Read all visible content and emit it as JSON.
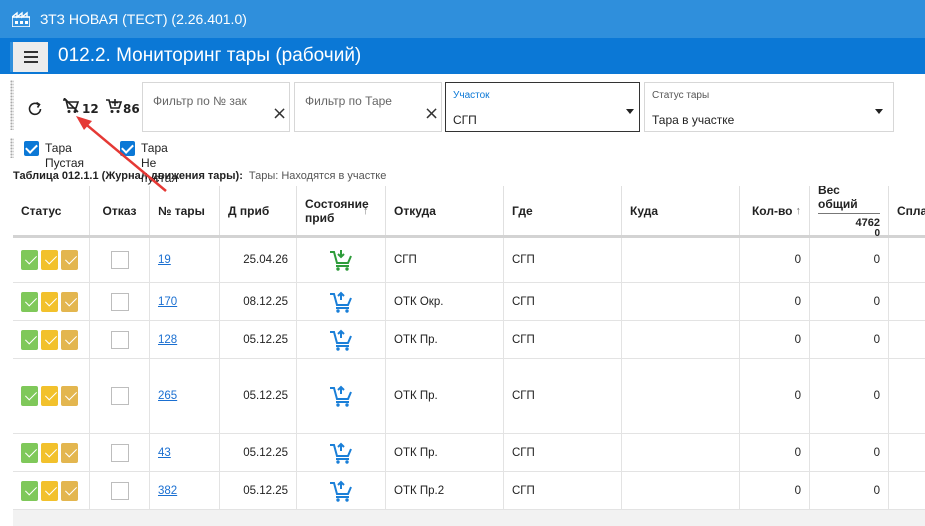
{
  "app": {
    "title": "ЗТЗ НОВАЯ (ТЕСТ) (2.26.401.0)"
  },
  "header": {
    "page_title": "012.2. Мониторинг тары (рабочий)"
  },
  "toolbar": {
    "empty_cart_count": "12",
    "full_cart_count": "86",
    "filter_order_placeholder": "Фильтр по № зак",
    "filter_tara_placeholder": "Фильтр по Таре",
    "area": {
      "label": "Участок",
      "value": "СГП"
    },
    "status": {
      "label": "Статус тары",
      "value": "Тара в участке"
    }
  },
  "checkboxes": {
    "empty": "Тара Пустая",
    "not_empty": "Тара Не пустая"
  },
  "table": {
    "caption": "Таблица 012.1.1 (Журнал движения тары):",
    "subcaption": "Тары: Находятся в участке",
    "headers": {
      "status": "Статус",
      "otkaz": "Отказ",
      "num": "№ тары",
      "date": "Д приб",
      "state": "Состояние приб",
      "from": "Откуда",
      "where": "Где",
      "to": "Куда",
      "qty": "Кол-во",
      "weight": "Вес общий",
      "weight_total": "4762",
      "weight_sub": "0",
      "spl": "Спла"
    },
    "rows": [
      {
        "num": "19",
        "date": "25.04.26",
        "from": "СГП",
        "where": "СГП",
        "qty": "0",
        "weight": "0",
        "cart": "green"
      },
      {
        "num": "170",
        "date": "08.12.25",
        "from": "ОТК Окр.",
        "where": "СГП",
        "qty": "0",
        "weight": "0",
        "cart": "blue"
      },
      {
        "num": "128",
        "date": "05.12.25",
        "from": "ОТК Пр.",
        "where": "СГП",
        "qty": "0",
        "weight": "0",
        "cart": "blue"
      },
      {
        "num": "265",
        "date": "05.12.25",
        "from": "ОТК Пр.",
        "where": "СГП",
        "qty": "0",
        "weight": "0",
        "cart": "blue"
      },
      {
        "num": "43",
        "date": "05.12.25",
        "from": "ОТК Пр.",
        "where": "СГП",
        "qty": "0",
        "weight": "0",
        "cart": "blue"
      },
      {
        "num": "382",
        "date": "05.12.25",
        "from": "ОТК Пр.2",
        "where": "СГП",
        "qty": "0",
        "weight": "0",
        "cart": "blue"
      }
    ]
  },
  "colors": {
    "title_bar": "#2f8fdc",
    "header_bar": "#0b78d6",
    "cart_green": "#2e9c3a",
    "cart_blue": "#1a7fd8",
    "arrow": "#e53935"
  },
  "icons": [
    "factory-icon",
    "menu-icon",
    "refresh-icon",
    "empty-cart-icon",
    "full-cart-icon",
    "clear-icon",
    "chevron-down-icon",
    "cart-download-icon",
    "cart-upload-icon"
  ]
}
